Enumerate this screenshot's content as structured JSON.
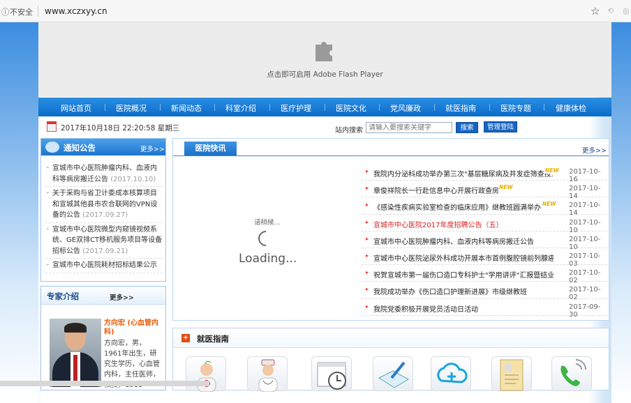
{
  "browser": {
    "info_icon": "ⓘ",
    "insecure_label": "不安全",
    "url": "www.xczxyy.cn",
    "star_icon": "☆"
  },
  "flash": {
    "text": "点击即可启用 Adobe Flash Player"
  },
  "nav": {
    "items": [
      "网站首页",
      "医院概况",
      "新闻动态",
      "科室介绍",
      "医疗护理",
      "医院文化",
      "党风廉政",
      "就医指南",
      "医院专题",
      "健康体检"
    ]
  },
  "topbar": {
    "datetime": "2017年10月18日 22:20:58 星期三",
    "search_label": "站内搜索",
    "search_placeholder": "请输入要搜索关键字",
    "search_button": "搜索",
    "admin_button": "管理登陆"
  },
  "notice": {
    "title": "通知公告",
    "more": "更多>>",
    "items": [
      {
        "text": "宣城市中心医院肿瘤内科、血液内科等病房搬迁公告",
        "date": "(2017.10.10)"
      },
      {
        "text": "关于采购与省卫计委成本核算项目和宣城其他县市农合联网的VPN设备的公告",
        "date": "(2017.09.27)"
      },
      {
        "text": "宣城市中心医院微型内窥镜视频系统、GE双排CT移机服务项目等设备招标公告",
        "date": "(2017.09.21)"
      },
      {
        "text": "宣城市中心医院耗材招标结果公示",
        "date": ""
      }
    ]
  },
  "expert": {
    "title": "专家介绍",
    "more": "更多>>",
    "name": "方向宏 (心血管内科)",
    "bio": "方向宏，男，1961年出生，研究生学历，心血管内科，主任医师，教授，1983"
  },
  "news": {
    "tab": "医院快讯",
    "more": "更多>>",
    "loading_small": "请稍候...",
    "loading": "Loading...",
    "items": [
      {
        "title": "我院内分泌科成功举办第三次\"基层糖尿病及并发症筛查技...",
        "date": "2017-10-16",
        "new": true,
        "red": false
      },
      {
        "title": "章俊祥院长一行赴信息中心开展行政查房",
        "date": "2017-10-14",
        "new": true,
        "red": false
      },
      {
        "title": "《感染性疾病实验室检查的临床应用》继教班圆满举办",
        "date": "2017-10-14",
        "new": true,
        "red": false
      },
      {
        "title": "宣城市中心医院2017年度招聘公告（五）",
        "date": "2017-10-10",
        "new": false,
        "red": true
      },
      {
        "title": "宣城市中心医院肿瘤内科、血液内科等病房搬迁公告",
        "date": "2017-10-10",
        "new": false,
        "red": false
      },
      {
        "title": "宣城市中心医院泌尿外科成功开展本市首例腹腔镜前列腺癌根...",
        "date": "2017-10-03",
        "new": false,
        "red": false
      },
      {
        "title": "祝贺宣城市第一届伤口造口专科护士\"学用讲评\"汇报暨结业...",
        "date": "2017-10-02",
        "new": false,
        "red": false
      },
      {
        "title": "我院成功举办《伤口造口护理新进展》市级继教班",
        "date": "2017-10-02",
        "new": false,
        "red": false
      },
      {
        "title": "我院党委积极开展党员活动日活动",
        "date": "2017-09-30",
        "new": false,
        "red": false
      }
    ],
    "new_badge": "NEW"
  },
  "guide": {
    "icon": "+",
    "title": "就医指南",
    "icons": [
      "doctor-icon",
      "nurse-icon",
      "calendar-clock-icon",
      "writing-icon",
      "health-cloud-icon",
      "document-icon",
      "phone-icon"
    ]
  }
}
